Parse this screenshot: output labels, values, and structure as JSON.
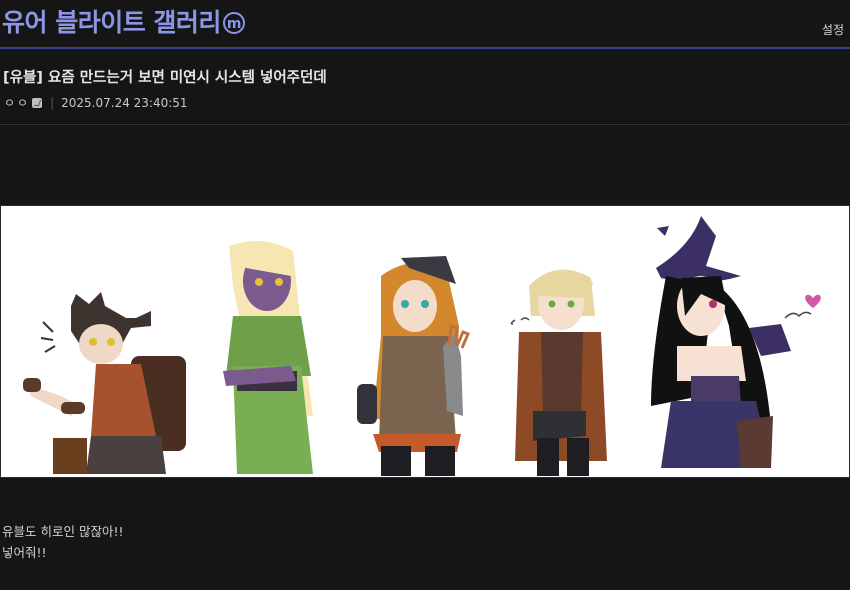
{
  "header": {
    "gallery_name": "유어 블라이트 갤러리",
    "badge": "m",
    "settings_label": "설정"
  },
  "post": {
    "title": "[유블] 요즘 만드는거 보면 미연시 시스템 넣어주던데",
    "author": "ㅇㅇ",
    "separator": "|",
    "datetime": "2025.07.24 23:40:51",
    "body": [
      "유블도 히로인 많잖아!!",
      "넣어줘!!"
    ]
  },
  "colors": {
    "accent": "#8d95e6",
    "accent_line": "#3a3f9a",
    "background": "#151515"
  }
}
